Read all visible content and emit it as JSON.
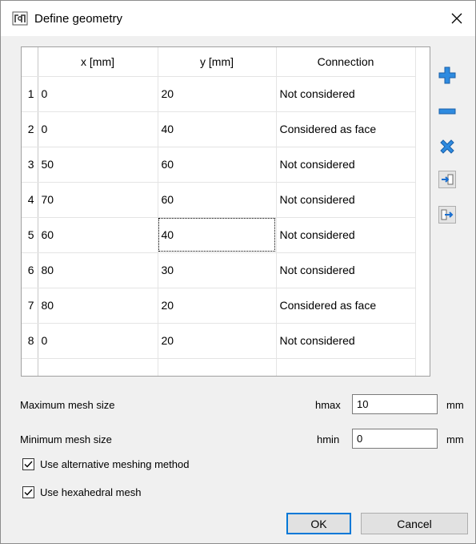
{
  "window": {
    "title": "Define geometry",
    "close_glyph": "✕"
  },
  "table": {
    "columns": [
      "x [mm]",
      "y [mm]",
      "Connection"
    ],
    "rows": [
      {
        "num": "1",
        "x": "0",
        "y": "20",
        "connection": "Not considered"
      },
      {
        "num": "2",
        "x": "0",
        "y": "40",
        "connection": "Considered as face"
      },
      {
        "num": "3",
        "x": "50",
        "y": "60",
        "connection": "Not considered"
      },
      {
        "num": "4",
        "x": "70",
        "y": "60",
        "connection": "Not considered"
      },
      {
        "num": "5",
        "x": "60",
        "y": "40",
        "connection": "Not considered"
      },
      {
        "num": "6",
        "x": "80",
        "y": "30",
        "connection": "Not considered"
      },
      {
        "num": "7",
        "x": "80",
        "y": "20",
        "connection": "Considered as face"
      },
      {
        "num": "8",
        "x": "0",
        "y": "20",
        "connection": "Not considered"
      }
    ]
  },
  "side_buttons": [
    "add-row-icon",
    "remove-row-icon",
    "delete-all-icon",
    "import-icon",
    "export-icon"
  ],
  "colors": {
    "accent_blue": "#2e8be0",
    "focus_border": "#0078d7"
  },
  "mesh": {
    "max_label": "Maximum mesh size",
    "max_symbol": "hmax",
    "max_value": "10",
    "max_unit": "mm",
    "min_label": "Minimum mesh size",
    "min_symbol": "hmin",
    "min_value": "0",
    "min_unit": "mm"
  },
  "options": {
    "alt_meshing_label": "Use alternative meshing method",
    "alt_meshing_checked": true,
    "hexa_label": "Use hexahedral mesh",
    "hexa_checked": true
  },
  "buttons": {
    "ok": "OK",
    "cancel": "Cancel"
  }
}
